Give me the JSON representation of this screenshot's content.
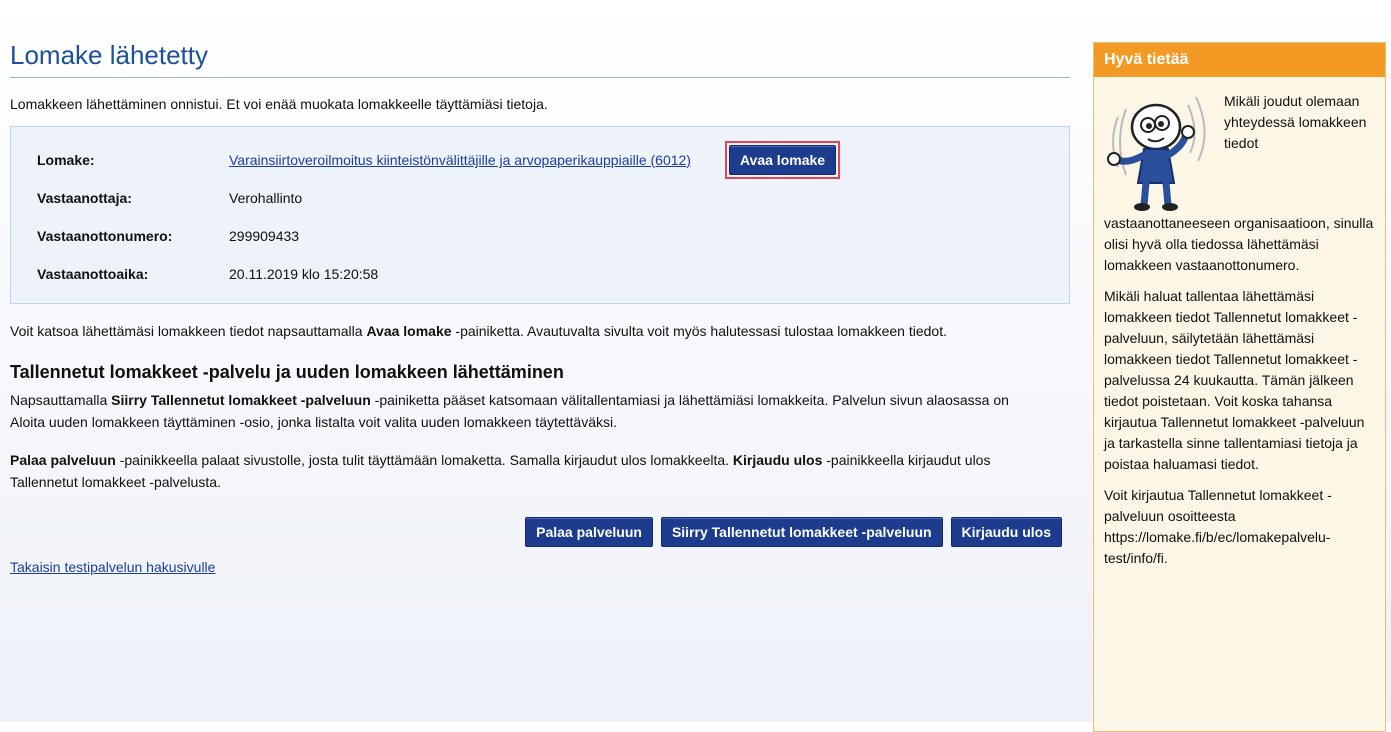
{
  "page": {
    "title": "Lomake lähetetty",
    "intro": "Lomakkeen lähettäminen onnistui. Et voi enää muokata lomakkeelle täyttämiäsi tietoja."
  },
  "info": {
    "form_label": "Lomake:",
    "form_link": "Varainsiirtoveroilmoitus kiinteistönvälittäjille ja arvopaperikauppiaille (6012)",
    "open_button": "Avaa lomake",
    "recipient_label": "Vastaanottaja:",
    "recipient_value": "Verohallinto",
    "number_label": "Vastaanottonumero:",
    "number_value": "299909433",
    "time_label": "Vastaanottoaika:",
    "time_value": "20.11.2019 klo 15:20:58"
  },
  "body": {
    "p1_pre": "Voit katsoa lähettämäsi lomakkeen tiedot napsauttamalla ",
    "p1_bold": "Avaa lomake",
    "p1_post": " -painiketta. Avautuvalta sivulta voit myös halutessasi tulostaa lomakkeen tiedot.",
    "subheading": "Tallennetut lomakkeet -palvelu ja uuden lomakkeen lähettäminen",
    "p2_pre": "Napsauttamalla ",
    "p2_bold": "Siirry Tallennetut lomakkeet -palveluun",
    "p2_post": " -painiketta pääset katsomaan välitallentamiasi ja lähettämiäsi lomakkeita. Palvelun sivun alaosassa on Aloita uuden lomakkeen täyttäminen -osio, jonka listalta voit valita uuden lomakkeen täytettäväksi.",
    "p3_bold1": "Palaa palveluun",
    "p3_mid": " -painikkeella palaat sivustolle, josta tulit täyttämään lomaketta. Samalla kirjaudut ulos lomakkeelta. ",
    "p3_bold2": "Kirjaudu ulos",
    "p3_post": " -painikkeella kirjaudut ulos Tallennetut lomakkeet -palvelusta."
  },
  "buttons": {
    "return": "Palaa palveluun",
    "saved_forms": "Siirry Tallennetut lomakkeet -palveluun",
    "logout": "Kirjaudu ulos"
  },
  "back_link": "Takaisin testipalvelun hakusivulle",
  "sidebar": {
    "heading": "Hyvä tietää",
    "p1_top": "Mikäli joudut olemaan yhteydessä lomakkeen tiedot",
    "p1_rest": "vastaanottaneeseen organisaatioon, sinulla olisi hyvä olla tiedossa lähettämäsi lomakkeen vastaanottonumero.",
    "p2": "Mikäli haluat tallentaa lähettämäsi lomakkeen tiedot Tallennetut lomakkeet -palveluun, säilytetään lähettämäsi lomakkeen tiedot Tallennetut lomakkeet -palvelussa 24 kuukautta. Tämän jälkeen tiedot poistetaan. Voit koska tahansa kirjautua Tallennetut lomakkeet -palveluun ja tarkastella sinne tallentamiasi tietoja ja poistaa haluamasi tiedot.",
    "p3": "Voit kirjautua Tallennetut lomakkeet -palveluun osoitteesta https://lomake.fi/b/ec/lomakepalvelu-test/info/fi."
  },
  "colors": {
    "accent": "#1d3c8e",
    "sidebar_header": "#f39a25",
    "highlight": "#e24556"
  }
}
